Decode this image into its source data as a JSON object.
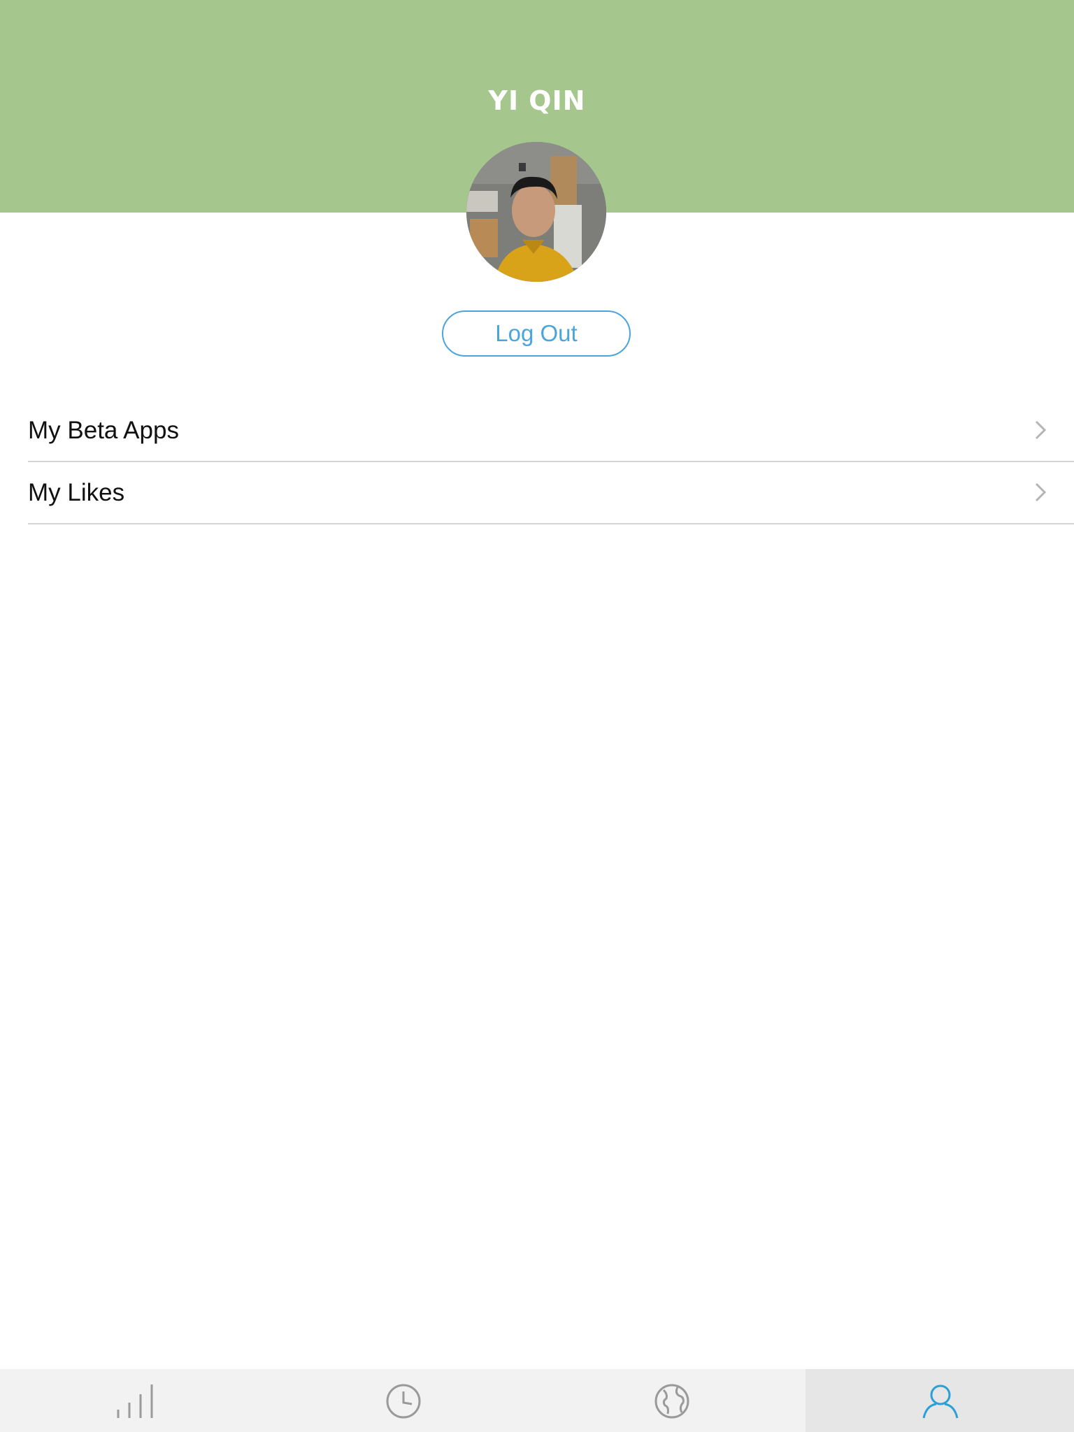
{
  "header": {
    "title": "YI QIN",
    "background_color": "#a5c78e"
  },
  "profile": {
    "avatar_icon": "profile-photo",
    "logout_label": "Log Out",
    "accent_color": "#4aa5dc"
  },
  "menu": {
    "items": [
      {
        "label": "My Beta Apps",
        "icon": "chevron-right-icon"
      },
      {
        "label": "My Likes",
        "icon": "chevron-right-icon"
      }
    ]
  },
  "tabbar": {
    "tabs": [
      {
        "icon": "signal-bars-icon",
        "active": false
      },
      {
        "icon": "clock-icon",
        "active": false
      },
      {
        "icon": "globe-icon",
        "active": false
      },
      {
        "icon": "user-icon",
        "active": true
      }
    ],
    "active_color": "#2a9fd8",
    "inactive_color": "#9a9a9a"
  }
}
